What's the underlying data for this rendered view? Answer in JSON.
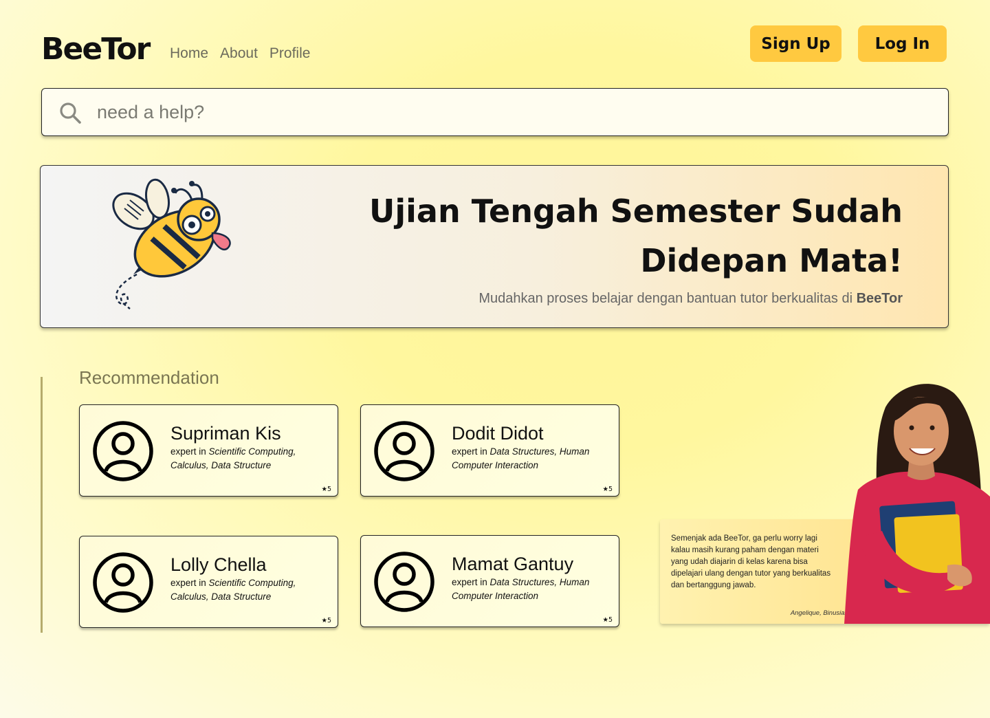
{
  "header": {
    "logo": "BeeTor",
    "nav": [
      "Home",
      "About",
      "Profile"
    ],
    "signup_label": "Sign Up",
    "login_label": "Log In"
  },
  "search": {
    "placeholder": "need a help?",
    "icon": "search-icon"
  },
  "banner": {
    "title_line1": "Ujian Tengah Semester Sudah",
    "title_line2": "Didepan Mata!",
    "subtitle_prefix": "Mudahkan proses belajar dengan bantuan tutor berkualitas di ",
    "subtitle_brand": "BeeTor",
    "illustration": "bee-illustration"
  },
  "recommendation": {
    "title": "Recommendation",
    "tutors": [
      {
        "name": "Supriman Kis",
        "expert_prefix": "expert in ",
        "expertise": "Scientific Computing, Calculus, Data Structure",
        "rating": "★5"
      },
      {
        "name": "Dodit Didot",
        "expert_prefix": "expert in ",
        "expertise": "Data Structures, Human Computer Interaction",
        "rating": "★5"
      },
      {
        "name": "Lolly Chella",
        "expert_prefix": "expert in ",
        "expertise": "Scientific Computing, Calculus, Data Structure",
        "rating": "★5"
      },
      {
        "name": "Mamat Gantuy",
        "expert_prefix": "expert in ",
        "expertise": "Data Structures, Human Computer Interaction",
        "rating": "★5"
      }
    ]
  },
  "testimonial": {
    "quote": "Semenjak ada BeeTor, ga perlu worry lagi kalau masih kurang paham dengan materi yang udah diajarin di kelas karena bisa dipelajari ulang dengan tutor yang berkualitas dan bertanggung jawab.",
    "author": "Angelique, Binusian 27"
  },
  "colors": {
    "accent": "#ffc940",
    "background": "#fff79e"
  }
}
